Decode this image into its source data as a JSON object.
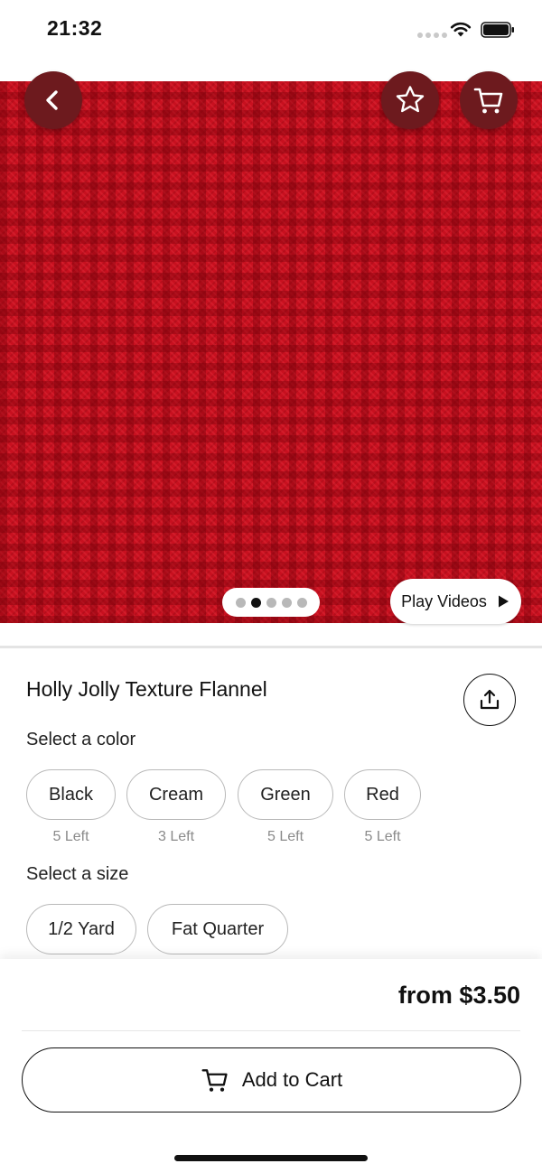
{
  "status_bar": {
    "time": "21:32"
  },
  "product": {
    "title": "Holly Jolly Texture Flannel",
    "image_color": "#c8101f",
    "image_index": 2,
    "image_count": 5
  },
  "header_buttons": {
    "back_icon": "chevron-left-icon",
    "favorite_icon": "star-icon",
    "cart_icon": "cart-icon"
  },
  "media": {
    "play_videos_label": "Play Videos"
  },
  "color_section": {
    "label": "Select a color",
    "options": [
      {
        "label": "Black",
        "stock": "5 Left"
      },
      {
        "label": "Cream",
        "stock": "3 Left"
      },
      {
        "label": "Green",
        "stock": "5 Left"
      },
      {
        "label": "Red",
        "stock": "5 Left"
      }
    ]
  },
  "size_section": {
    "label": "Select a size",
    "options": [
      {
        "label": "1/2 Yard"
      },
      {
        "label": "Fat Quarter"
      }
    ]
  },
  "purchase": {
    "price": "from $3.50",
    "add_to_cart_label": "Add to Cart"
  }
}
